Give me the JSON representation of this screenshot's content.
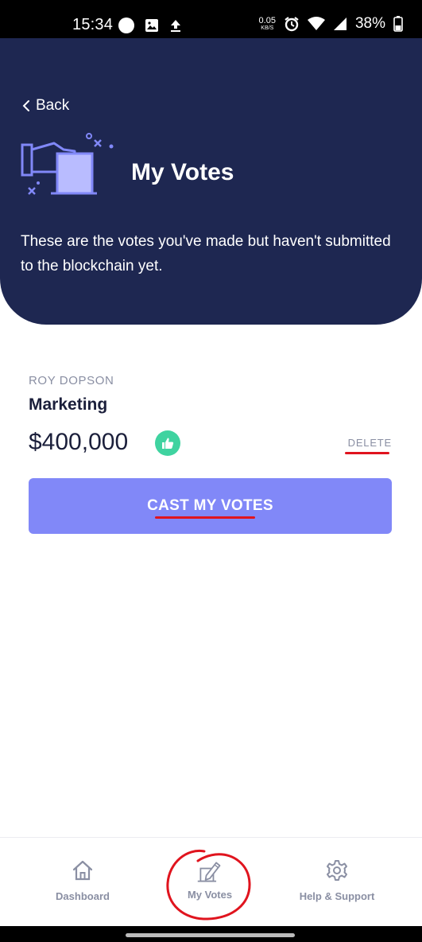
{
  "status_bar": {
    "time": "15:34",
    "speed_value": "0.05",
    "speed_unit": "KB/S",
    "battery": "38%"
  },
  "header": {
    "back_label": "Back",
    "title": "My Votes",
    "subtitle": "These are the votes you've made but haven't submitted to the blockchain yet."
  },
  "vote": {
    "author": "ROY DOPSON",
    "project": "Marketing",
    "amount": "$400,000",
    "delete_label": "DELETE"
  },
  "cast_button": {
    "label": "CAST MY VOTES"
  },
  "bottom_nav": {
    "items": [
      {
        "label": "Dashboard",
        "icon": "home-icon"
      },
      {
        "label": "My Votes",
        "icon": "ballot-pen-icon"
      },
      {
        "label": "Help & Support",
        "icon": "gear-icon"
      }
    ]
  },
  "colors": {
    "header_bg": "#1e2751",
    "accent": "#8188f8",
    "like_badge": "#3fd3a0",
    "annotation_red": "#e0141e",
    "muted_text": "#8a8fa3"
  }
}
